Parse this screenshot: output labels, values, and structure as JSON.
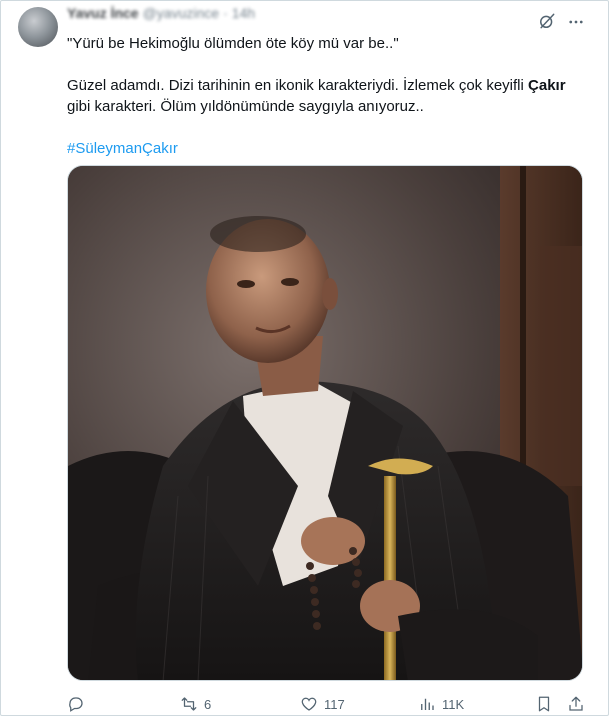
{
  "header": {
    "display_name": "Yavuz İnce",
    "handle": "@yavuzince",
    "time": "14h"
  },
  "tweet": {
    "line1": "\"Yürü be Hekimoğlu ölümden öte köy mü var be..\"",
    "line2_pre": "Güzel adamdı. Dizi tarihinin en ikonik karakteriydi. İzlemek çok keyifli ",
    "line2_bold": "Çakır",
    "line3": "gibi karakteri. Ölüm yıldönümünde saygıyla anıyoruz..",
    "hashtag": "#SüleymanÇakır"
  },
  "actions": {
    "replies": "",
    "reposts": "6",
    "likes": "117",
    "views": "11K"
  },
  "icons": {
    "grok": "grok-icon",
    "more": "more-icon",
    "reply": "reply-icon",
    "repost": "repost-icon",
    "like": "heart-icon",
    "views": "views-icon",
    "bookmark": "bookmark-icon",
    "share": "share-icon"
  },
  "colors": {
    "accent": "#1d9bf0",
    "secondary_text": "#536471",
    "border": "#cfd9de"
  }
}
